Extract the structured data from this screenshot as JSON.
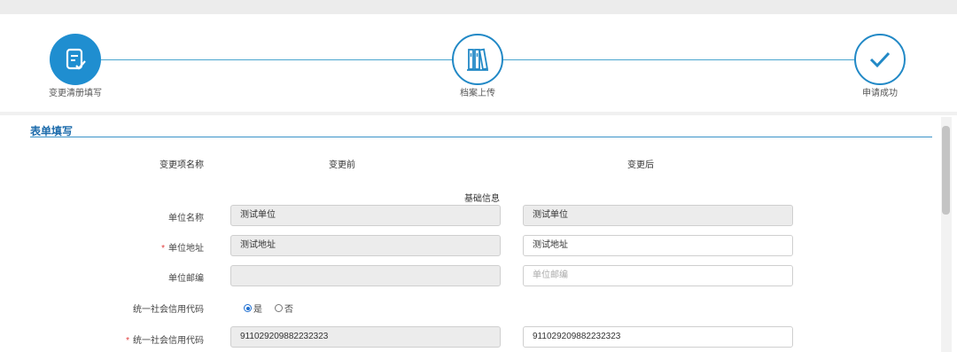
{
  "steps": [
    {
      "label": "变更清册填写",
      "state": "active",
      "icon": "form-edit-icon"
    },
    {
      "label": "档案上传",
      "state": "pending",
      "icon": "archive-binders-icon"
    },
    {
      "label": "申请成功",
      "state": "pending",
      "icon": "checkmark-icon"
    }
  ],
  "form": {
    "section_title": "表单填写",
    "columns": {
      "name": "变更项名称",
      "before": "变更前",
      "after": "变更后"
    },
    "group_label": "基础信息",
    "rows": [
      {
        "label": "单位名称",
        "required": false,
        "before": "测试单位",
        "after": "测试单位",
        "after_placeholder": ""
      },
      {
        "label": "单位地址",
        "required": true,
        "before": "测试地址",
        "after": "测试地址",
        "after_placeholder": ""
      },
      {
        "label": "单位邮编",
        "required": false,
        "before": "",
        "after": "",
        "after_placeholder": "单位邮编"
      },
      {
        "label": "统一社会信用代码",
        "required": false,
        "radio_yes": "是",
        "radio_no": "否",
        "selected": "是"
      },
      {
        "label": "统一社会信用代码",
        "required": true,
        "before": "911029209882232323",
        "after": "911029209882232323",
        "after_placeholder": ""
      }
    ],
    "required_mark": "*"
  },
  "colors": {
    "accent": "#1f8ed0",
    "line": "#4aa6cf",
    "title": "#1c6bab",
    "required": "#e23b3b"
  }
}
